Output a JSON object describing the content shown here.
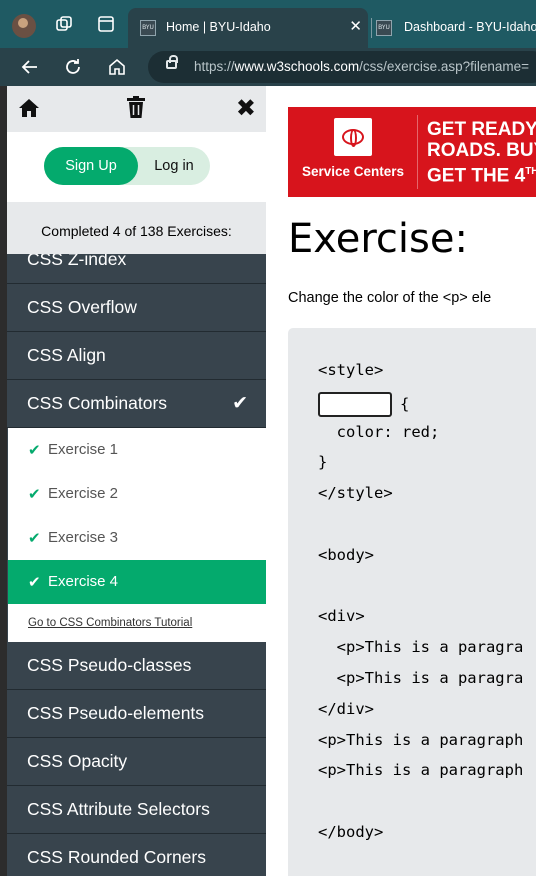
{
  "browser": {
    "tabs": [
      {
        "title": "Home | BYU-Idaho",
        "favicon": "BYU",
        "active": true
      },
      {
        "title": "Dashboard - BYU-Idaho",
        "favicon": "BYU",
        "active": false
      }
    ],
    "url_prefix": "https://",
    "url_host": "www.w3schools.com",
    "url_path": "/css/exercise.asp?filename="
  },
  "sidebar": {
    "signup_label": "Sign Up",
    "login_label": "Log in",
    "progress": "Completed 4 of 138 Exercises:",
    "topics_before": [
      "CSS Z-index",
      "CSS Overflow",
      "CSS Align"
    ],
    "current_topic": {
      "label": "CSS Combinators",
      "check": "✔"
    },
    "exercises": [
      {
        "label": "Exercise 1",
        "done": true
      },
      {
        "label": "Exercise 2",
        "done": true
      },
      {
        "label": "Exercise 3",
        "done": true
      },
      {
        "label": "Exercise 4",
        "done": true,
        "current": true
      }
    ],
    "tutorial_link": "Go to CSS Combinators Tutorial",
    "topics_after": [
      "CSS Pseudo-classes",
      "CSS Pseudo-elements",
      "CSS Opacity",
      "CSS Attribute Selectors",
      "CSS Rounded Corners"
    ]
  },
  "ad": {
    "brand_label": "Service Centers",
    "headline_lines": [
      "GET READY",
      "ROADS. BUY",
      "GET THE 4"
    ],
    "headline_sup": "TH",
    "accent_color": "#d7141c"
  },
  "main": {
    "title": "Exercise:",
    "description": "Change the color of the <p> ele",
    "code_lines": [
      "<style>",
      "{BLANK} {",
      "  color: red;",
      "}",
      "</style>",
      "",
      "<body>",
      "",
      "<div>",
      "  <p>This is a paragra",
      "  <p>This is a paragra",
      "</div>",
      "<p>This is a paragraph",
      "<p>This is a paragraph",
      "",
      "</body>"
    ]
  },
  "colors": {
    "w3_green": "#04aa6d",
    "sidebar_dark": "#38444d",
    "tabbar": "#1f5a63"
  }
}
